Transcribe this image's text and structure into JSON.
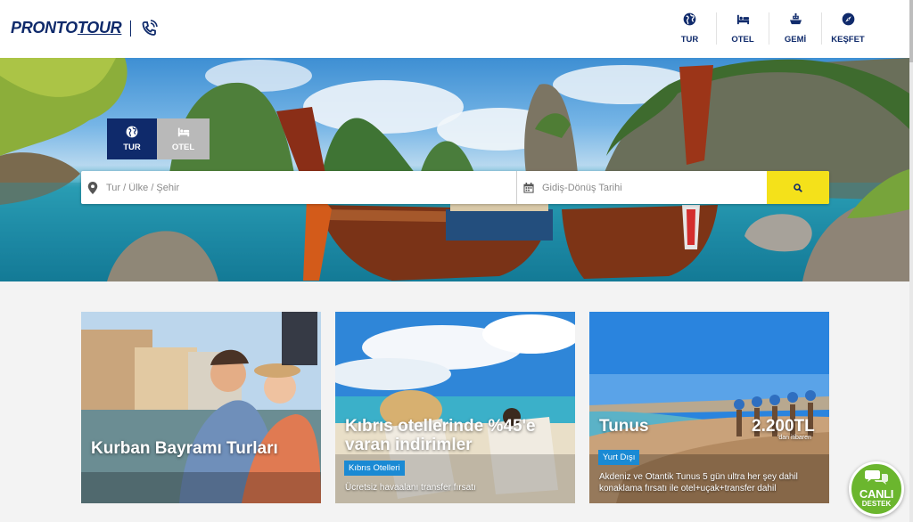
{
  "brand": {
    "logo_part1": "PRONTO",
    "logo_part2": "TOUR"
  },
  "nav": [
    {
      "label": "TUR",
      "icon": "globe-icon"
    },
    {
      "label": "OTEL",
      "icon": "bed-icon"
    },
    {
      "label": "GEMİ",
      "icon": "ship-icon"
    },
    {
      "label": "KEŞFET",
      "icon": "compass-icon"
    }
  ],
  "search": {
    "tabs": [
      {
        "label": "TUR",
        "icon": "globe-icon",
        "active": true
      },
      {
        "label": "OTEL",
        "icon": "bed-icon",
        "active": false
      }
    ],
    "destination_placeholder": "Tur / Ülke / Şehir",
    "date_placeholder": "Gidiş-Dönüş Tarihi",
    "button_icon": "search-icon"
  },
  "cards": [
    {
      "title": "Kurban Bayramı Turları"
    },
    {
      "title": "Kıbrıs otellerinde %45'e varan indirimler",
      "badge": "Kıbrıs Otelleri",
      "description": "Ücretsiz havaalanı transfer fırsatı"
    },
    {
      "title": "Tunus",
      "price": "2.200TL",
      "price_note": "'dan itibaren",
      "badge": "Yurt Dışı",
      "description": "Akdeniz ve Otantik Tunus 5 gün ultra her şey dahil konaklama fırsatı ile otel+uçak+transfer dahil"
    }
  ],
  "live_support": {
    "line1": "CANLI",
    "line2": "DESTEK"
  },
  "colors": {
    "brand_navy": "#0f2a6b",
    "search_button": "#f4e11a",
    "badge_blue": "#1a8ad4",
    "live_green": "#6bb62e"
  }
}
